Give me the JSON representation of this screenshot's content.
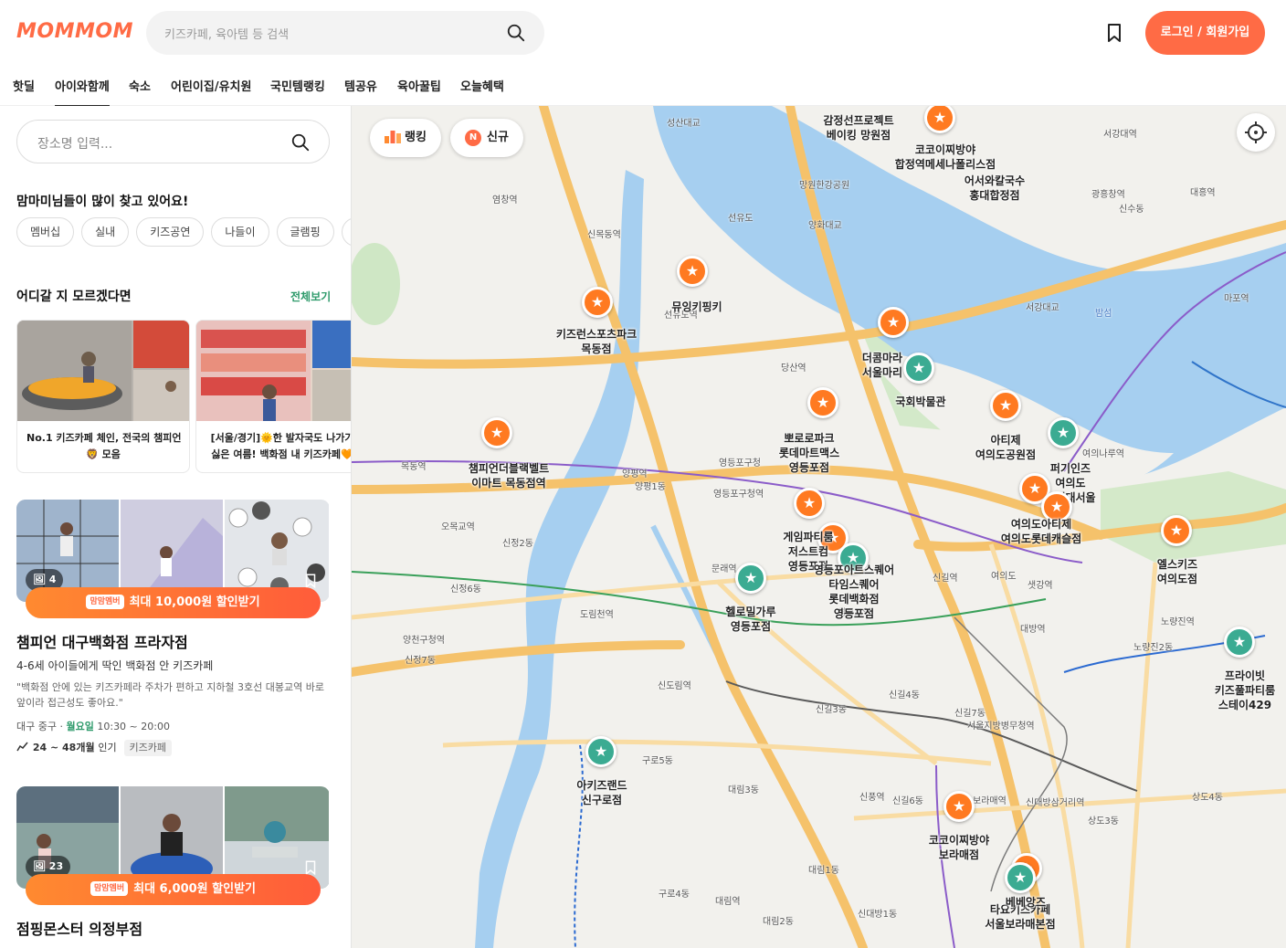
{
  "header": {
    "logo": "MOMMOM",
    "search_placeholder": "키즈카페, 육아템 등 검색",
    "login_label": "로그인 / 회원가입"
  },
  "nav": [
    "핫딜",
    "아이와함께",
    "숙소",
    "어린이집/유치원",
    "국민템랭킹",
    "템공유",
    "육아꿀팁",
    "오늘혜택"
  ],
  "sidebar": {
    "place_placeholder": "장소명 입력...",
    "popular_title": "맘마미님들이 많이 찾고 있어요!",
    "chips": [
      "멤버십",
      "실내",
      "키즈공연",
      "나들이",
      "글램핑",
      "캠핑"
    ],
    "unsure_title": "어디갈 지 모르겠다면",
    "see_all": "전체보기",
    "rec_cards": [
      {
        "line1": "No.1 키즈카페 체인, 전국의 챔피언",
        "line2": "모음",
        "emoji": "🦁"
      },
      {
        "line1": "[서울/경기]🌞한 발자국도 나가기",
        "line2": "싫은 여름! 백화점 내 키즈카페🧡"
      }
    ],
    "places": [
      {
        "photo_count": "4",
        "discount_tag": "맘맘멤버",
        "discount": "최대 10,000원 할인받기",
        "name": "챔피언 대구백화점 프라자점",
        "desc": "4-6세 아이들에게 딱인 백화점 안 키즈카페",
        "review": "\"백화점 안에 있는 키즈카페라 주차가 편하고 지하철 3호선 대봉교역 바로 앞이라 접근성도 좋아요.\"",
        "region": "대구 중구",
        "day": "월요일",
        "hours": "10:30 ~ 20:00",
        "age": "24 ~ 48개월",
        "age_suffix": "인기",
        "category": "키즈카페"
      },
      {
        "photo_count": "23",
        "discount_tag": "맘맘멤버",
        "discount": "최대 6,000원 할인받기",
        "name": "점핑몬스터 의정부점"
      }
    ]
  },
  "map": {
    "ranking_label": "랭킹",
    "new_label": "신규",
    "new_badge": "N",
    "pins": [
      {
        "label": "감정선프로젝트\n베이킹 망원점",
        "type": "orange"
      },
      {
        "label": "코코이찌방야\n합정역메세나폴리스점",
        "type": "orange"
      },
      {
        "label": "어서와칼국수\n홍대합정점",
        "type": "orange"
      },
      {
        "label": "뮤잉키핑키",
        "type": "orange"
      },
      {
        "label": "키즈런스포츠파크\n목동점",
        "type": "orange"
      },
      {
        "label": "더콤마라\n서울마리",
        "type": "orange"
      },
      {
        "label": "국회박물관",
        "type": "green"
      },
      {
        "label": "뽀로로파크\n롯데마트맥스\n영등포점",
        "type": "orange"
      },
      {
        "label": "챔피언더블랙벨트\n이마트 목동점역",
        "type": "orange"
      },
      {
        "label": "아티제\n여의도공원점",
        "type": "orange"
      },
      {
        "label": "퍼기인즈\n여의도\n더현대서울",
        "type": "green"
      },
      {
        "label": "여의도아티제\n여의도롯데캐슬점",
        "type": "orange"
      },
      {
        "label": "게임파티룸\n저스트컴\n영등포점",
        "type": "orange"
      },
      {
        "label": "영등포아트스퀘어\n타임스퀘어\n롯데백화점\n영등포점",
        "type": "green"
      },
      {
        "label": "헬로밀가루\n영등포점",
        "type": "green"
      },
      {
        "label": "엘스키즈\n여의도점",
        "type": "orange"
      },
      {
        "label": "프라이빗\n키즈풀파티룸\n스테이429",
        "type": "green"
      },
      {
        "label": "아키즈랜드\n신구로점",
        "type": "green"
      },
      {
        "label": "코코이찌방야\n보라매점",
        "type": "orange"
      },
      {
        "label": "타요키즈카페\n서울보라매본점",
        "type": "green"
      },
      {
        "label": "베베앙즈",
        "type": "orange"
      }
    ],
    "places": [
      "성산대교",
      "망원한강공원",
      "양화대교",
      "선유도",
      "서강대교",
      "밤섬",
      "서강대역",
      "광흥창역",
      "신수동",
      "대흥역",
      "마포역",
      "염창역",
      "신목동역",
      "양평역",
      "선유도역",
      "당산역",
      "영등포구청역",
      "문래역",
      "영등포구청",
      "목동역",
      "오목교역",
      "양평1동",
      "신정2동",
      "신정6동",
      "도림천역",
      "양천구청역",
      "신정7동",
      "신도림역",
      "구로5동",
      "대림3동",
      "신길3동",
      "신길4동",
      "신길7동",
      "신풍역",
      "신길6동",
      "대림1동",
      "구로4동",
      "대림역",
      "대림2동",
      "신대방1동",
      "상도4동",
      "상도3동",
      "대방역",
      "노량진역",
      "노량진2동",
      "신길역",
      "샛강역",
      "여의나루역",
      "서울지방병무청역",
      "신대방삼거리역",
      "보라매역",
      "영등포역",
      "여의도"
    ]
  }
}
